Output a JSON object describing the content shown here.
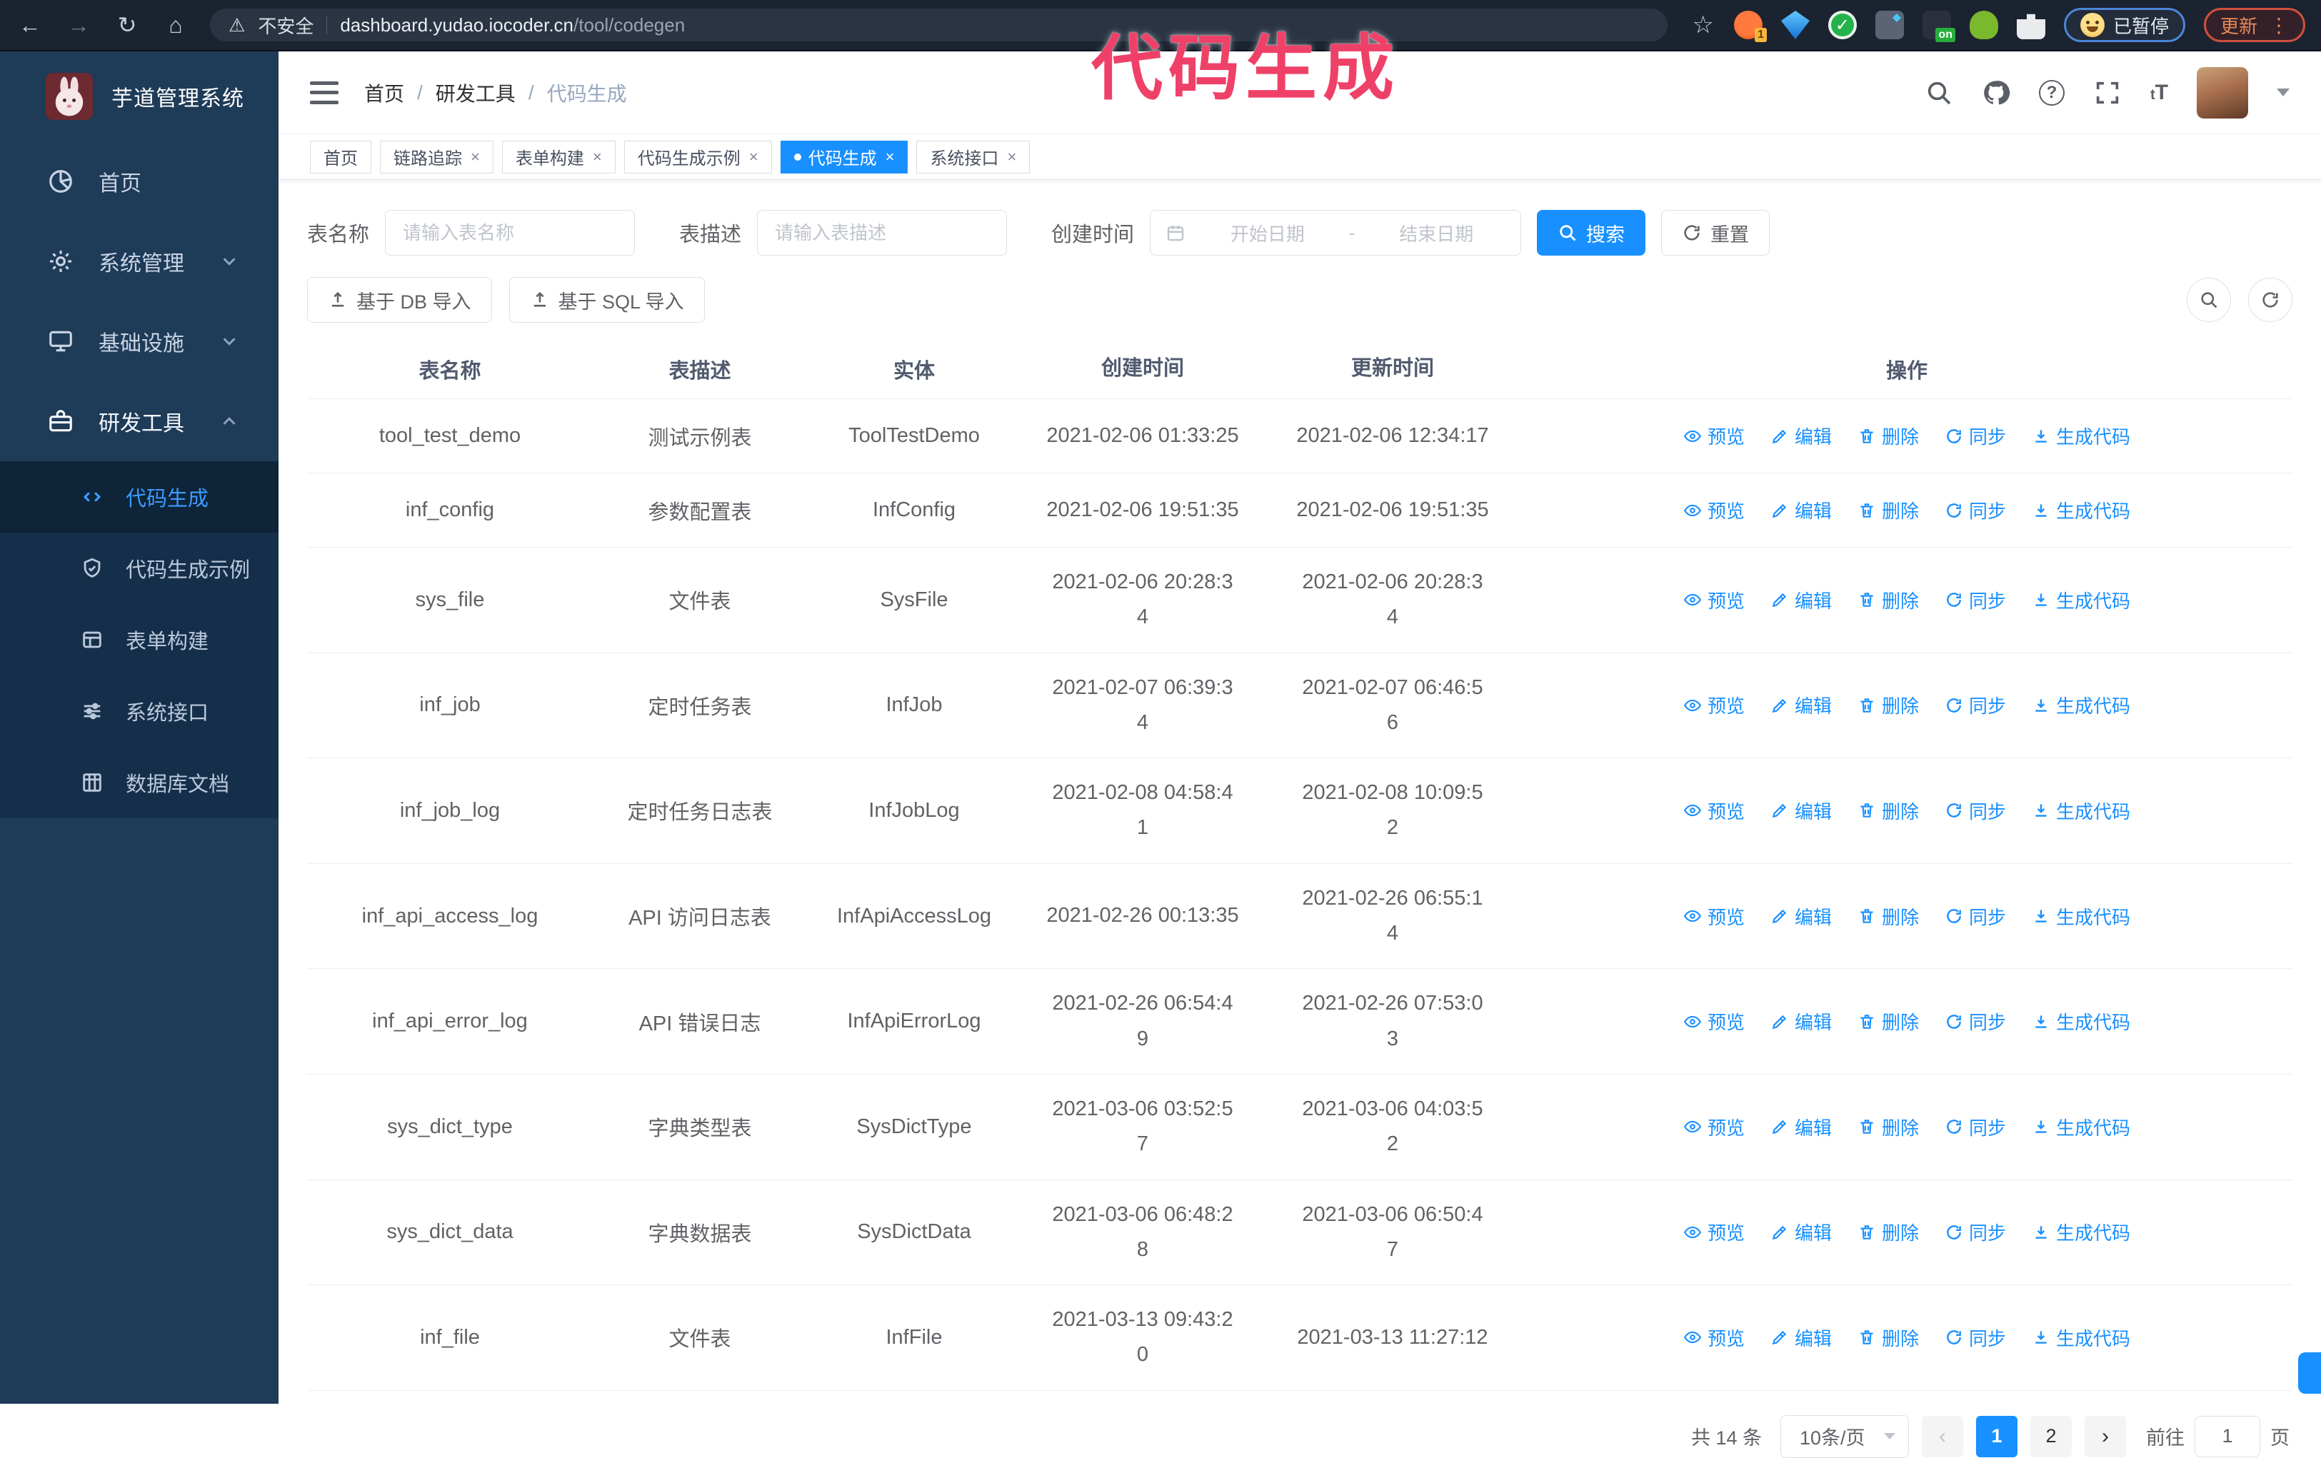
{
  "browser": {
    "security_label": "不安全",
    "url_host": "dashboard.yudao.iocoder.cn",
    "url_path": "/tool/codegen",
    "paused_label": "已暂停",
    "update_label": "更新"
  },
  "annotation": {
    "text": "代码生成"
  },
  "sidebar": {
    "logo_title": "芋道管理系统",
    "items": [
      {
        "label": "首页",
        "icon": "dashboard",
        "chevron": "",
        "active": false
      },
      {
        "label": "系统管理",
        "icon": "gear",
        "chevron": "down",
        "active": false
      },
      {
        "label": "基础设施",
        "icon": "infra",
        "chevron": "down",
        "active": false
      },
      {
        "label": "研发工具",
        "icon": "tools",
        "chevron": "up",
        "active": true
      }
    ],
    "submenu": [
      {
        "label": "代码生成",
        "icon": "code",
        "active": true
      },
      {
        "label": "代码生成示例",
        "icon": "example",
        "active": false
      },
      {
        "label": "表单构建",
        "icon": "form",
        "active": false
      },
      {
        "label": "系统接口",
        "icon": "api",
        "active": false
      },
      {
        "label": "数据库文档",
        "icon": "db",
        "active": false
      }
    ]
  },
  "breadcrumb": [
    "首页",
    "研发工具",
    "代码生成"
  ],
  "tabs": [
    {
      "label": "首页",
      "closable": false,
      "active": false
    },
    {
      "label": "链路追踪",
      "closable": true,
      "active": false
    },
    {
      "label": "表单构建",
      "closable": true,
      "active": false
    },
    {
      "label": "代码生成示例",
      "closable": true,
      "active": false
    },
    {
      "label": "代码生成",
      "closable": true,
      "active": true
    },
    {
      "label": "系统接口",
      "closable": true,
      "active": false
    }
  ],
  "filters": {
    "name_label": "表名称",
    "name_placeholder": "请输入表名称",
    "desc_label": "表描述",
    "desc_placeholder": "请输入表描述",
    "time_label": "创建时间",
    "start_placeholder": "开始日期",
    "range_separator": "-",
    "end_placeholder": "结束日期",
    "search_label": "搜索",
    "reset_label": "重置"
  },
  "toolbar": {
    "import_db": "基于 DB 导入",
    "import_sql": "基于 SQL 导入"
  },
  "table": {
    "columns": [
      "表名称",
      "表描述",
      "实体",
      "创建时间",
      "更新时间",
      "操作"
    ],
    "rows": [
      {
        "name": "tool_test_demo",
        "desc": "测试示例表",
        "entity": "ToolTestDemo",
        "created": "2021-02-06 01:33:25",
        "updated": "2021-02-06 12:34:17"
      },
      {
        "name": "inf_config",
        "desc": "参数配置表",
        "entity": "InfConfig",
        "created": "2021-02-06 19:51:35",
        "updated": "2021-02-06 19:51:35"
      },
      {
        "name": "sys_file",
        "desc": "文件表",
        "entity": "SysFile",
        "created": "2021-02-06 20:28:3\n4",
        "updated": "2021-02-06 20:28:3\n4"
      },
      {
        "name": "inf_job",
        "desc": "定时任务表",
        "entity": "InfJob",
        "created": "2021-02-07 06:39:3\n4",
        "updated": "2021-02-07 06:46:5\n6"
      },
      {
        "name": "inf_job_log",
        "desc": "定时任务日志表",
        "entity": "InfJobLog",
        "created": "2021-02-08 04:58:4\n1",
        "updated": "2021-02-08 10:09:5\n2"
      },
      {
        "name": "inf_api_access_log",
        "desc": "API 访问日志表",
        "entity": "InfApiAccessLog",
        "created": "2021-02-26 00:13:35",
        "updated": "2021-02-26 06:55:1\n4"
      },
      {
        "name": "inf_api_error_log",
        "desc": "API 错误日志",
        "entity": "InfApiErrorLog",
        "created": "2021-02-26 06:54:4\n9",
        "updated": "2021-02-26 07:53:0\n3"
      },
      {
        "name": "sys_dict_type",
        "desc": "字典类型表",
        "entity": "SysDictType",
        "created": "2021-03-06 03:52:5\n7",
        "updated": "2021-03-06 04:03:5\n2"
      },
      {
        "name": "sys_dict_data",
        "desc": "字典数据表",
        "entity": "SysDictData",
        "created": "2021-03-06 06:48:2\n8",
        "updated": "2021-03-06 06:50:4\n7"
      },
      {
        "name": "inf_file",
        "desc": "文件表",
        "entity": "InfFile",
        "created": "2021-03-13 09:43:2\n0",
        "updated": "2021-03-13 11:27:12"
      }
    ],
    "row_actions": [
      {
        "label": "预览",
        "icon": "eye"
      },
      {
        "label": "编辑",
        "icon": "edit"
      },
      {
        "label": "删除",
        "icon": "trash"
      },
      {
        "label": "同步",
        "icon": "sync"
      },
      {
        "label": "生成代码",
        "icon": "download"
      }
    ]
  },
  "pagination": {
    "total": "共 14 条",
    "page_size": "10条/页",
    "pages": [
      "1",
      "2"
    ],
    "active_page": "1",
    "goto_label": "前往",
    "goto_value": "1",
    "page_unit": "页"
  },
  "colors": {
    "primary": "#1890ff",
    "annotation": "#ef4168",
    "sidebar_bg": "#1e3b58",
    "submenu_bg": "#152f4b",
    "active_item_bg": "#0d2439"
  }
}
